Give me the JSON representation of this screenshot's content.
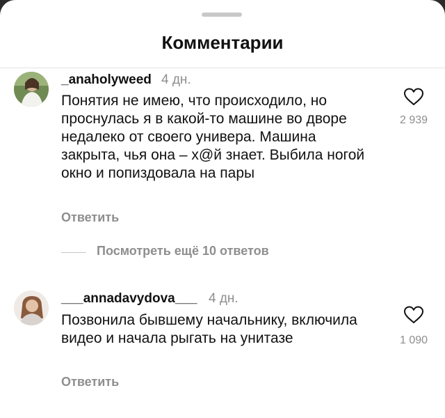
{
  "header": {
    "title": "Комментарии"
  },
  "comments": [
    {
      "username": "_anaholyweed",
      "time": "4 дн.",
      "text": "Понятия не имею, что происходило, но проснулась я в какой-то машине во дворе недалеко от своего универа. Машина закрыта, чья она – х@й знает. Выбила ногой окно и попиздовала на пары",
      "likes": "2 939",
      "reply_label": "Ответить"
    },
    {
      "username": "___annadavydova___",
      "time": "4 дн.",
      "text": "Позвонила бывшему начальнику, включила видео и начала рыгать на унитазе",
      "likes": "1 090",
      "reply_label": "Ответить"
    }
  ],
  "view_more_label": "Посмотреть ещё 10 ответов",
  "icons": {
    "like": "heart-outline-icon",
    "handle": "drag-handle"
  },
  "colors": {
    "secondary_text": "#8e8e8e",
    "primary_text": "#111111",
    "background": "#ffffff"
  }
}
